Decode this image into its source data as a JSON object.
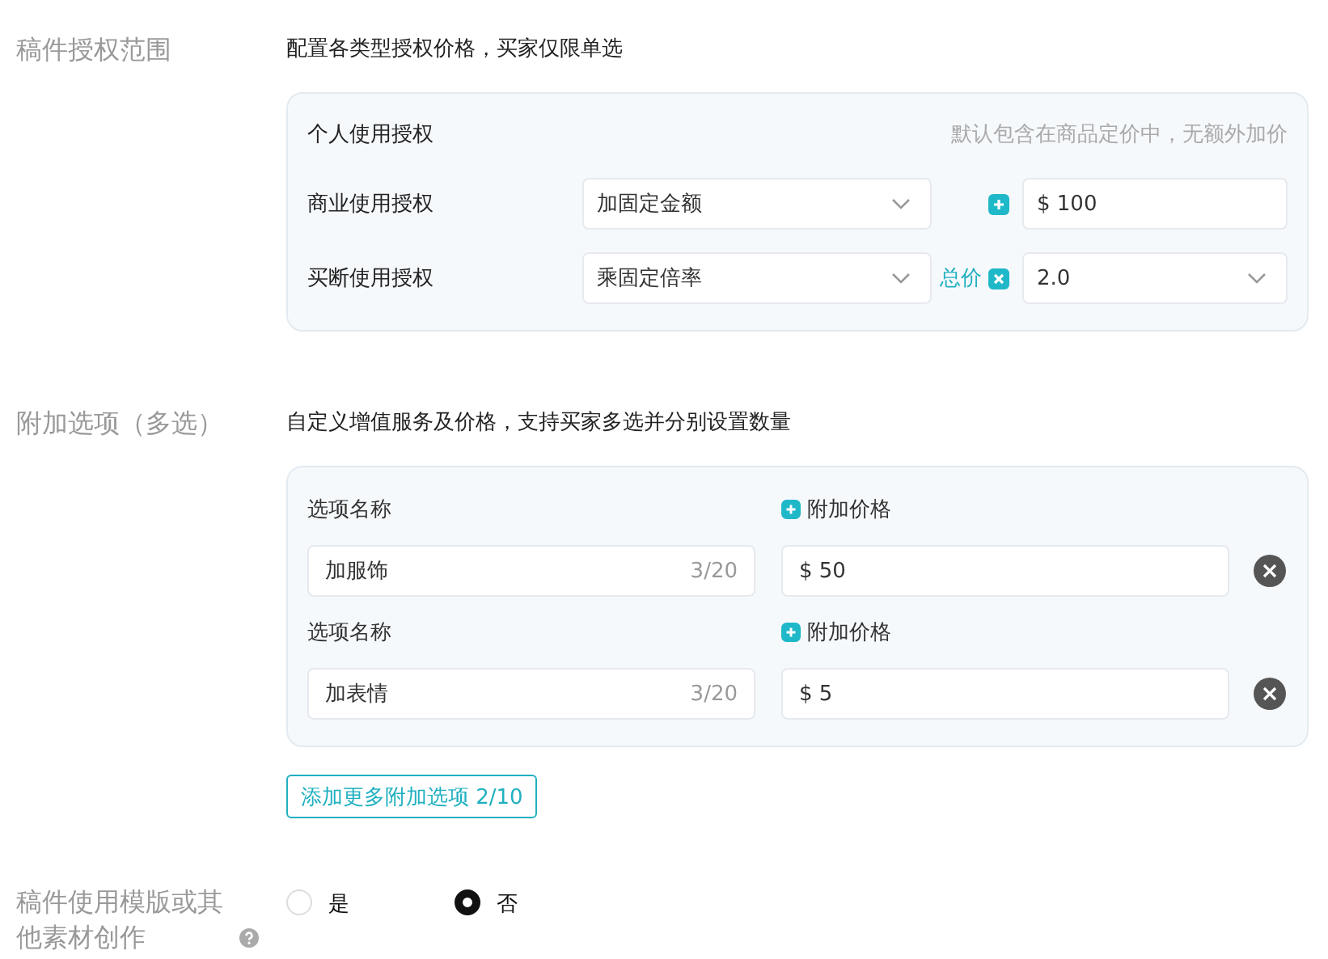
{
  "license": {
    "label": "稿件授权范围",
    "description": "配置各类型授权价格，买家仅限单选",
    "personal": {
      "name": "个人使用授权",
      "note": "默认包含在商品定价中，无额外加价"
    },
    "rows": [
      {
        "name": "商业使用授权",
        "mode": "加固定金额",
        "prefix": "",
        "kind": "plus",
        "value": "$ 100",
        "value_dropdown": false
      },
      {
        "name": "买断使用授权",
        "mode": "乘固定倍率",
        "prefix": "总价",
        "kind": "times",
        "value": "2.0",
        "value_dropdown": true
      }
    ]
  },
  "addons": {
    "label": "附加选项（多选）",
    "description": "自定义增值服务及价格，支持买家多选并分别设置数量",
    "options": [
      {
        "name_label": "选项名称",
        "name": "加服饰",
        "count": "3/20",
        "price_label": "附加价格",
        "price": "$ 50"
      },
      {
        "name_label": "选项名称",
        "name": "加表情",
        "count": "3/20",
        "price_label": "附加价格",
        "price": "$ 5"
      }
    ],
    "add_button": "添加更多附加选项 2/10"
  },
  "template": {
    "label": "稿件使用模版或其他素材创作",
    "options": [
      {
        "label": "是",
        "selected": false
      },
      {
        "label": "否",
        "selected": true
      }
    ]
  }
}
